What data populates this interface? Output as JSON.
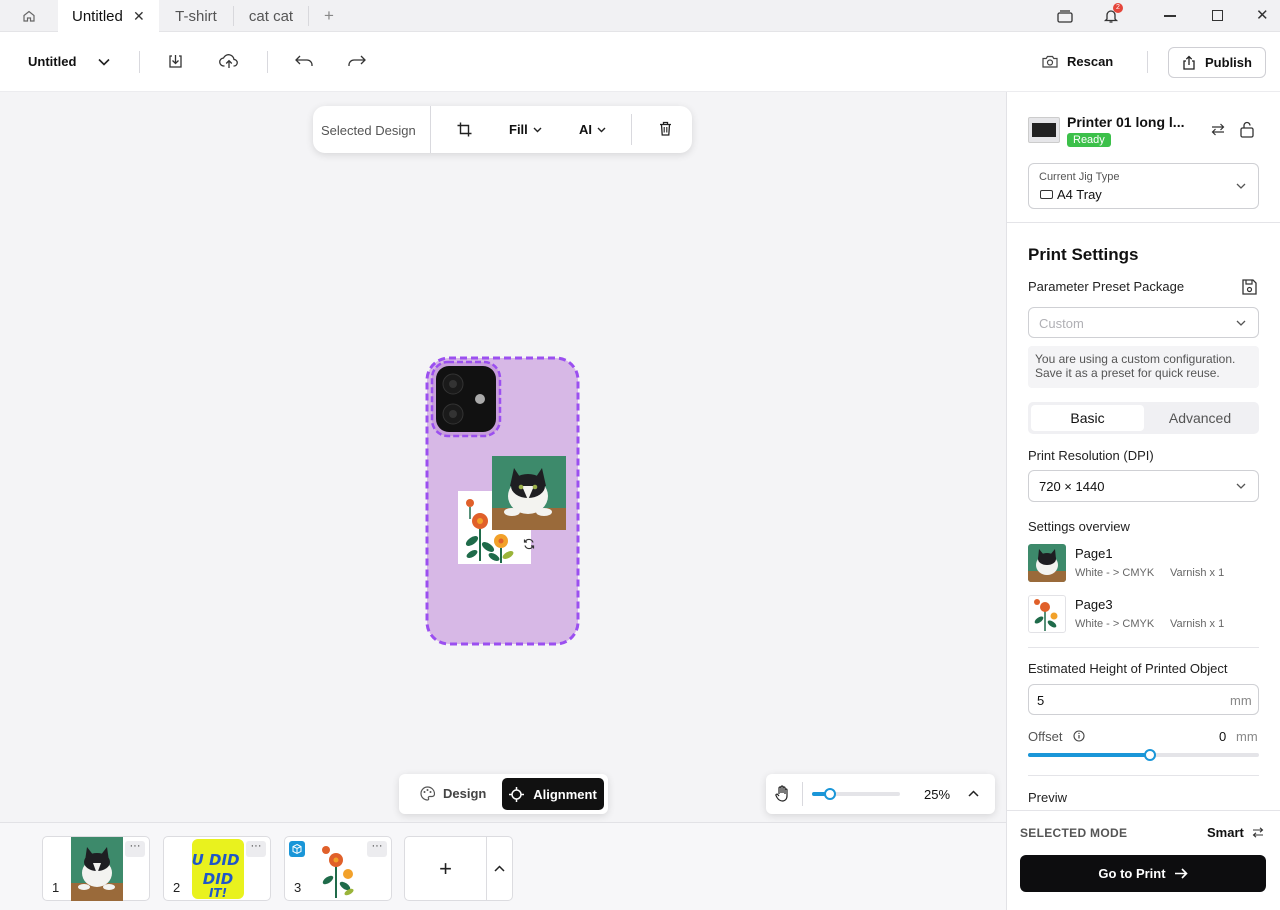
{
  "tabs": [
    {
      "label": "Untitled",
      "active": true
    },
    {
      "label": "T-shirt",
      "active": false
    },
    {
      "label": "cat cat",
      "active": false
    }
  ],
  "notification_count": "2",
  "toolbar": {
    "project_name": "Untitled",
    "rescan_label": "Rescan",
    "publish_label": "Publish"
  },
  "floating_toolbar": {
    "selected_label": "Selected Design",
    "fill_label": "Fill",
    "ai_label": "AI"
  },
  "mode_switch": {
    "design_label": "Design",
    "alignment_label": "Alignment",
    "active": "Alignment"
  },
  "zoom": {
    "label": "25%",
    "value_fraction": 0.2
  },
  "printer": {
    "name": "Printer 01 long l...",
    "status": "Ready"
  },
  "jig": {
    "label": "Current Jig Type",
    "value": "A4 Tray"
  },
  "print_settings": {
    "title": "Print Settings",
    "preset_label": "Parameter Preset Package",
    "preset_placeholder": "Custom",
    "preset_note_line1": "You are using a custom configuration.",
    "preset_note_line2": "Save it as a preset for quick reuse.",
    "tabs": [
      "Basic",
      "Advanced"
    ],
    "active_tab": "Basic",
    "resolution_label": "Print Resolution (DPI)",
    "resolution_value": "720 × 1440",
    "overview_label": "Settings overview",
    "overview_items": [
      {
        "name": "Page1",
        "mode": "White - > CMYK",
        "varnish": "Varnish x 1"
      },
      {
        "name": "Page3",
        "mode": "White - > CMYK",
        "varnish": "Varnish x 1"
      }
    ],
    "height_label": "Estimated Height of Printed Object",
    "height_value": "5",
    "height_unit": "mm",
    "offset_label": "Offset",
    "offset_value": "0",
    "offset_unit": "mm",
    "offset_fraction": 0.53,
    "preview_label": "Previw"
  },
  "footer": {
    "selected_mode_label": "SELECTED MODE",
    "selected_mode_value": "Smart",
    "go_print_label": "Go to Print"
  },
  "pages": [
    {
      "number": "1",
      "content": "cat-photo"
    },
    {
      "number": "2",
      "content": "you-did-it-sticker",
      "text": "YOU DID IT!"
    },
    {
      "number": "3",
      "content": "flower-illustration"
    }
  ],
  "colors": {
    "accent": "#1a96d8",
    "ready": "#3cc04a",
    "phone_case": "#d7b8e6",
    "selection": "#9b4ff0",
    "notification": "#e5453a"
  }
}
